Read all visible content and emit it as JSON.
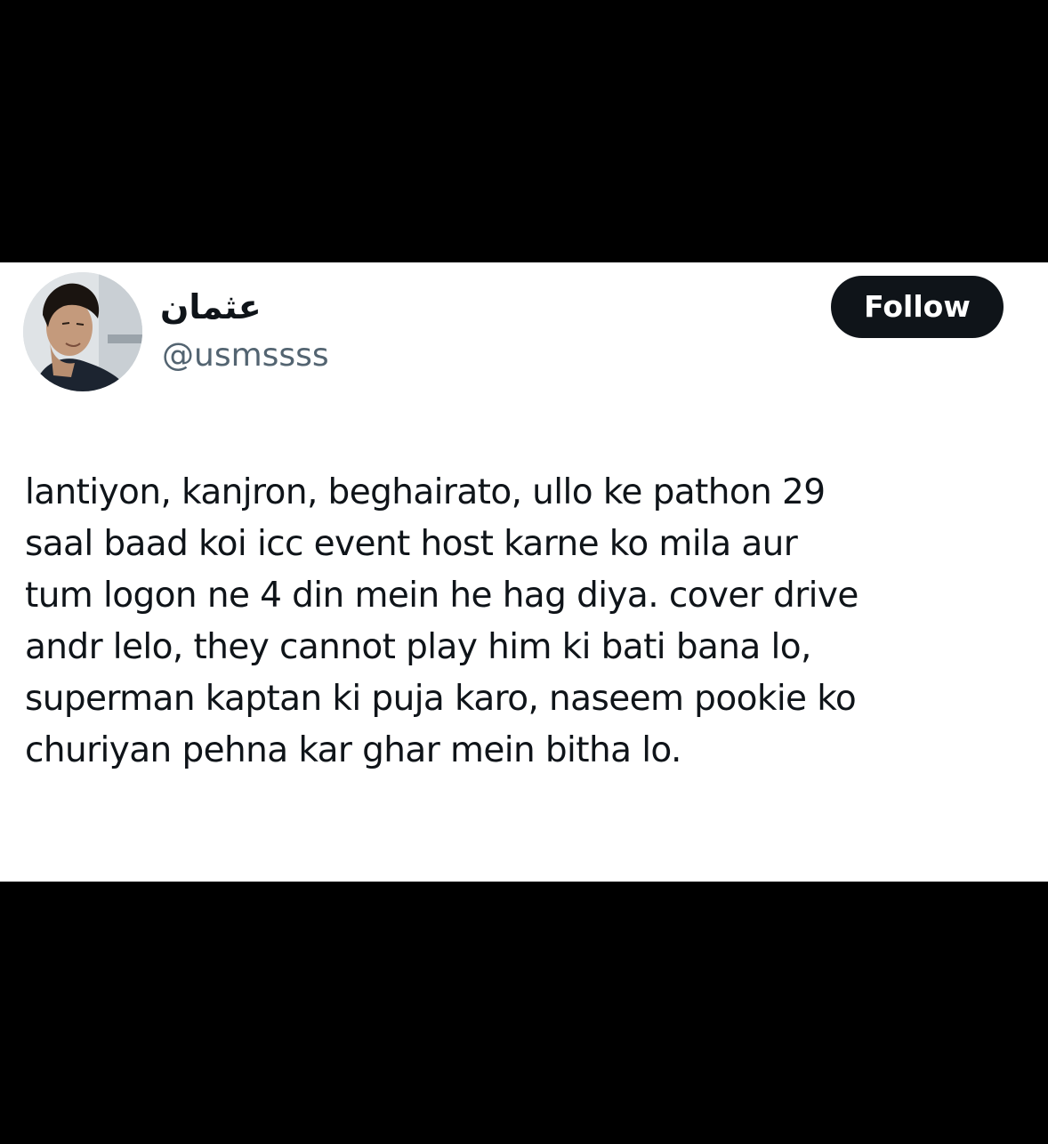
{
  "tweet": {
    "author": {
      "display_name": "عثمان",
      "handle": "@usmssss",
      "avatar_icon": "profile-photo"
    },
    "follow_label": "Follow",
    "text_lines": [
      "lantiyon, kanjron, beghairato, ullo ke pathon 29",
      "saal baad koi icc event host karne ko mila aur",
      "tum logon ne 4 din mein he hag diya. cover drive",
      "andr lelo, they cannot play him ki bati bana lo,",
      "superman kaptan ki puja karo, naseem pookie ko",
      "churiyan pehna kar ghar mein bitha lo."
    ]
  },
  "colors": {
    "letterbox": "#000000",
    "card_background": "#ffffff",
    "primary_text": "#0f1419",
    "secondary_text": "#536471",
    "follow_button_bg": "#0f1419",
    "follow_button_text": "#ffffff"
  }
}
